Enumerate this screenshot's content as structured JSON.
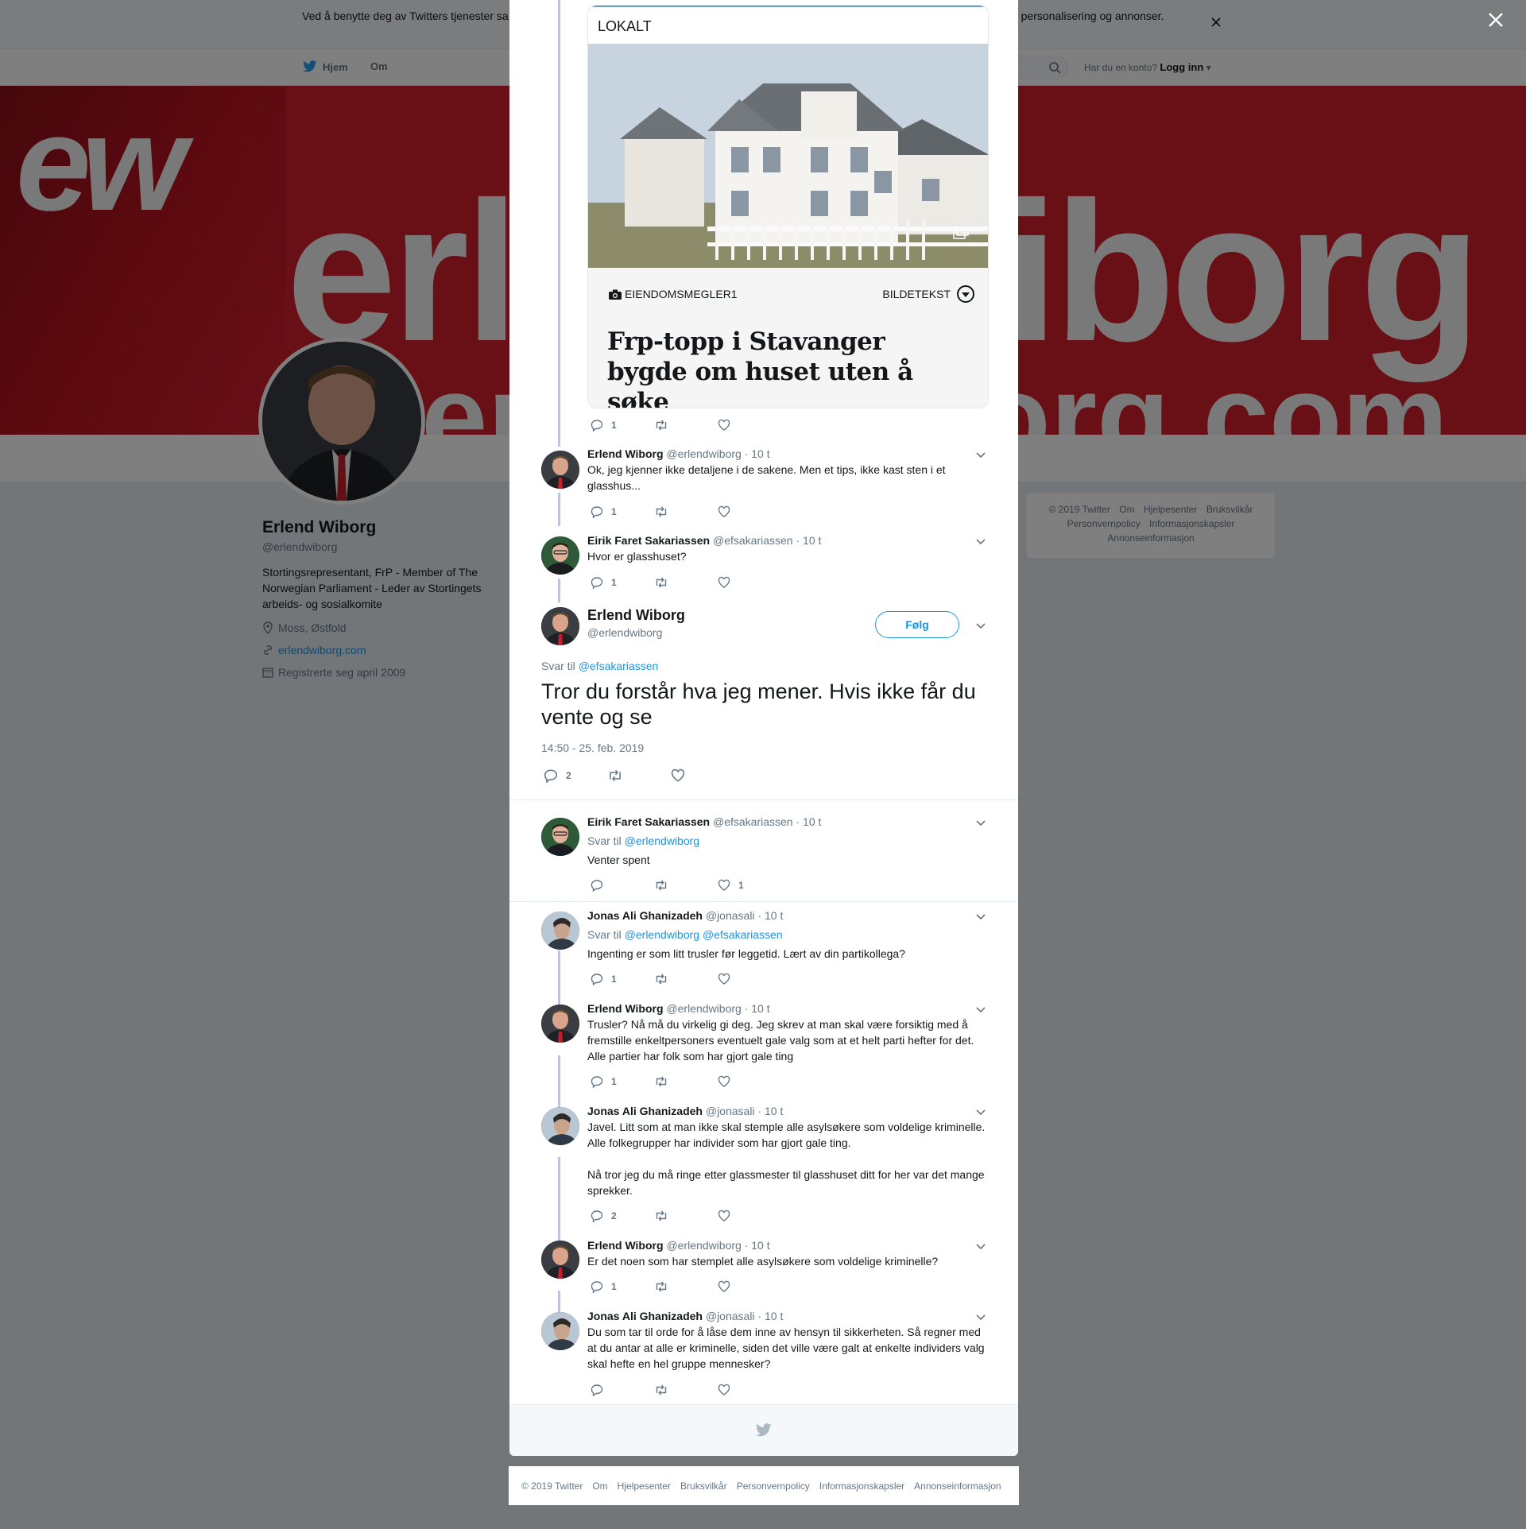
{
  "cookie_notice": {
    "text": "Ved å benytte deg av Twitters tjenester sa                                                                                                          informasjonskapsler til bl.a. analyser, personalisering og annonser."
  },
  "nav": {
    "home_label": "Hjem",
    "about_label": "Om",
    "account_prompt": "Har du en konto?",
    "login_label": "Logg inn"
  },
  "banner": {
    "logo_text": "ew",
    "word": "erlendwiborg",
    "word2": "erlendwiborg.com"
  },
  "profile": {
    "name": "Erlend Wiborg",
    "handle": "@erlendwiborg",
    "bio": "Stortingsrepresentant, FrP - Member of The Norwegian Parliament - Leder av Stortingets arbeids- og sosialkomite",
    "location": "Moss, Østfold",
    "website": "erlendwiborg.com",
    "joined": "Registrerte seg april 2009"
  },
  "side_footer": {
    "links": [
      "© 2019 Twitter",
      "Om",
      "Hjelpesenter",
      "Bruksvilkår",
      "Personvernpolicy",
      "Informasjonskapsler",
      "Annonseinformasjon"
    ]
  },
  "card": {
    "section": "LOKALT",
    "photo_credit": "EIENDOMSMEGLER1",
    "caption_label": "BILDETEKST",
    "headline": "Frp-topp i Stavanger bygde om huset uten å søke",
    "reply_count": "1",
    "retweet_count": "",
    "like_count": ""
  },
  "tweets_before": [
    {
      "name": "Erlend Wiborg",
      "handle": "@erlendwiborg",
      "time": "· 10 t",
      "text": "Ok, jeg kjenner ikke detaljene i de sakene. Men et tips, ikke kast sten i et glasshus...",
      "reply_count": "1",
      "retweet_count": "",
      "like_count": ""
    },
    {
      "name": "Eirik Faret Sakariassen",
      "handle": "@efsakariassen",
      "time": "· 10 t",
      "text": "Hvor er glasshuset?",
      "reply_count": "1",
      "retweet_count": "",
      "like_count": ""
    }
  ],
  "main_tweet": {
    "name": "Erlend Wiborg",
    "handle": "@erlendwiborg",
    "follow_label": "Følg",
    "reply_prefix": "Svar til",
    "reply_to": "@efsakariassen",
    "text": "Tror du forstår hva jeg mener. Hvis ikke får du vente og se",
    "timestamp": "14:50 - 25. feb. 2019",
    "reply_count": "2",
    "retweet_count": "",
    "like_count": ""
  },
  "replies": [
    {
      "name": "Eirik Faret Sakariassen",
      "handle": "@efsakariassen",
      "time": "· 10 t",
      "reply_prefix": "Svar til",
      "reply_to_1": "@erlendwiborg",
      "reply_to_2": "",
      "text": "Venter spent",
      "reply_count": "",
      "retweet_count": "",
      "like_count": "1"
    },
    {
      "name": "Jonas Ali Ghanizadeh",
      "handle": "@jonasali",
      "time": "· 10 t",
      "reply_prefix": "Svar til",
      "reply_to_1": "@erlendwiborg",
      "reply_to_2": "@efsakariassen",
      "text": "Ingenting er som litt trusler før leggetid. Lært av din partikollega?",
      "reply_count": "1",
      "retweet_count": "",
      "like_count": ""
    },
    {
      "name": "Erlend Wiborg",
      "handle": "@erlendwiborg",
      "time": "· 10 t",
      "text": "Trusler? Nå må du virkelig gi deg. Jeg skrev at man skal være forsiktig med å fremstille enkeltpersoners eventuelt gale valg som at et helt parti hefter for det. Alle partier har folk som har gjort gale ting",
      "reply_count": "1",
      "retweet_count": "",
      "like_count": ""
    },
    {
      "name": "Jonas Ali Ghanizadeh",
      "handle": "@jonasali",
      "time": "· 10 t",
      "text": "Javel. Litt som at man ikke skal stemple alle asylsøkere som voldelige kriminelle. Alle folkegrupper har individer som har gjort gale ting.",
      "text2": "Nå tror jeg du må ringe etter glassmester til glasshuset ditt for her var det mange sprekker.",
      "reply_count": "2",
      "retweet_count": "",
      "like_count": ""
    },
    {
      "name": "Erlend Wiborg",
      "handle": "@erlendwiborg",
      "time": "· 10 t",
      "text": "Er det noen som har stemplet alle asylsøkere som voldelige kriminelle?",
      "reply_count": "1",
      "retweet_count": "",
      "like_count": ""
    },
    {
      "name": "Jonas Ali Ghanizadeh",
      "handle": "@jonasali",
      "time": "· 10 t",
      "text": "Du som tar til orde for å låse dem inne av hensyn til sikkerheten. Så regner med at du antar at alle er kriminelle, siden det ville være galt at enkelte individers valg skal hefte en hel gruppe mennesker?",
      "reply_count": "",
      "retweet_count": "",
      "like_count": ""
    }
  ],
  "page_footer": {
    "links": [
      "© 2019 Twitter",
      "Om",
      "Hjelpesenter",
      "Bruksvilkår",
      "Personvernpolicy",
      "Informasjonskapsler",
      "Annonseinformasjon"
    ]
  },
  "colors": {
    "accent": "#1b95e0",
    "thread_line": "#c4bfe7",
    "banner": "#d2202e",
    "overlay": "rgba(0,0,0,0.5)"
  }
}
